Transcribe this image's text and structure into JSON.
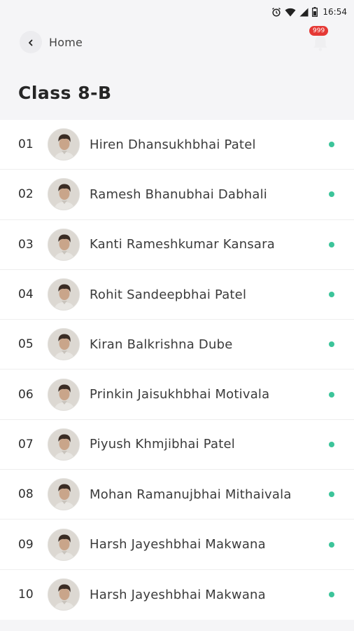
{
  "status_bar": {
    "time": "16:54",
    "icons": [
      "alarm-icon",
      "wifi-icon",
      "signal-icon",
      "battery-icon"
    ]
  },
  "header": {
    "back_label": "Home",
    "notification_count": "999"
  },
  "page": {
    "title": "Class 8-B"
  },
  "colors": {
    "online_dot": "#3cc49a",
    "badge": "#e53935"
  },
  "students": [
    {
      "roll": "01",
      "name": "Hiren Dhansukhbhai Patel"
    },
    {
      "roll": "02",
      "name": "Ramesh Bhanubhai Dabhali"
    },
    {
      "roll": "03",
      "name": "Kanti Rameshkumar Kansara"
    },
    {
      "roll": "04",
      "name": "Rohit Sandeepbhai Patel"
    },
    {
      "roll": "05",
      "name": "Kiran Balkrishna Dube"
    },
    {
      "roll": "06",
      "name": "Prinkin Jaisukhbhai Motivala"
    },
    {
      "roll": "07",
      "name": "Piyush Khmjibhai Patel"
    },
    {
      "roll": "08",
      "name": "Mohan Ramanujbhai Mithaivala"
    },
    {
      "roll": "09",
      "name": "Harsh Jayeshbhai Makwana"
    },
    {
      "roll": "10",
      "name": "Harsh Jayeshbhai Makwana"
    }
  ]
}
